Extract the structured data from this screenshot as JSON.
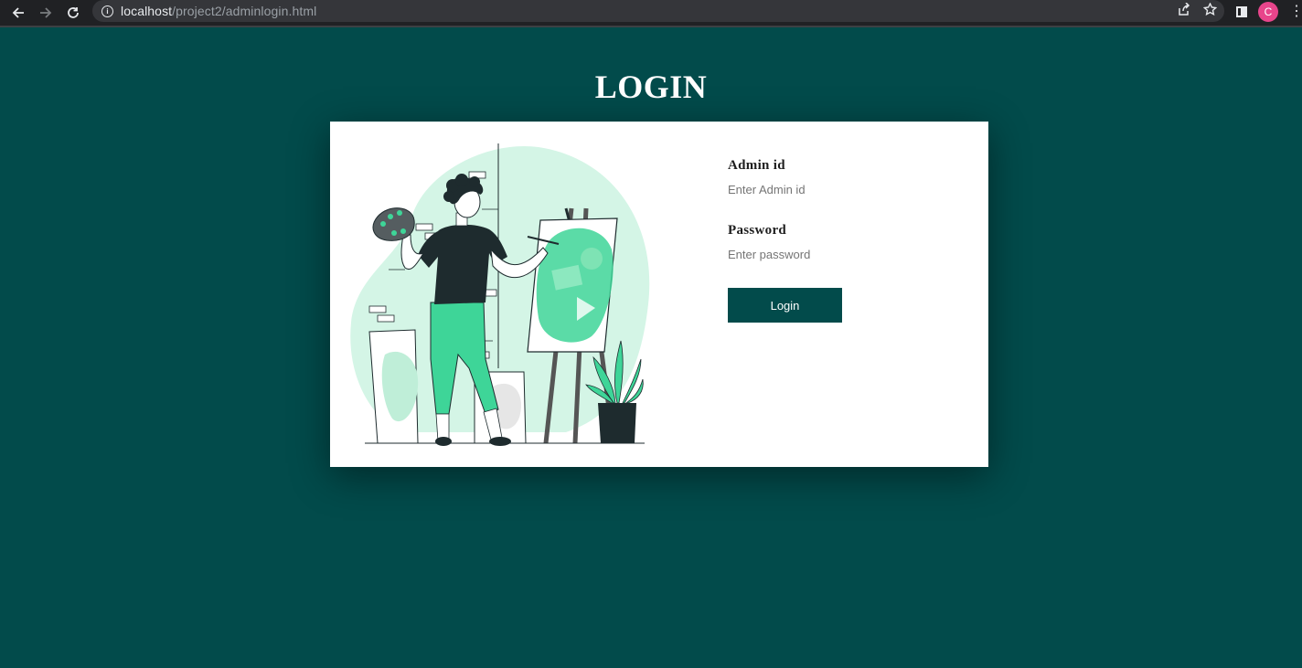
{
  "browser": {
    "url_host": "localhost",
    "url_path": "/project2/adminlogin.html",
    "profile_initial": "C"
  },
  "page": {
    "title": "LOGIN"
  },
  "form": {
    "admin_id": {
      "label": "Admin id",
      "placeholder": "Enter Admin id",
      "value": ""
    },
    "password": {
      "label": "Password",
      "placeholder": "Enter password",
      "value": ""
    },
    "submit_label": "Login"
  },
  "colors": {
    "page_background": "#024b4b",
    "card_background": "#ffffff",
    "button_background": "#024b4b",
    "illustration_accent": "#3ed598",
    "illustration_light": "#d4f5e6",
    "illustration_dark": "#1e2b2e"
  },
  "icons": {
    "back": "arrow-left-icon",
    "forward": "arrow-right-icon",
    "reload": "reload-icon",
    "site_info": "info-icon",
    "share": "share-icon",
    "bookmark": "star-icon",
    "side_panel": "side-panel-icon",
    "menu": "kebab-menu-icon"
  }
}
